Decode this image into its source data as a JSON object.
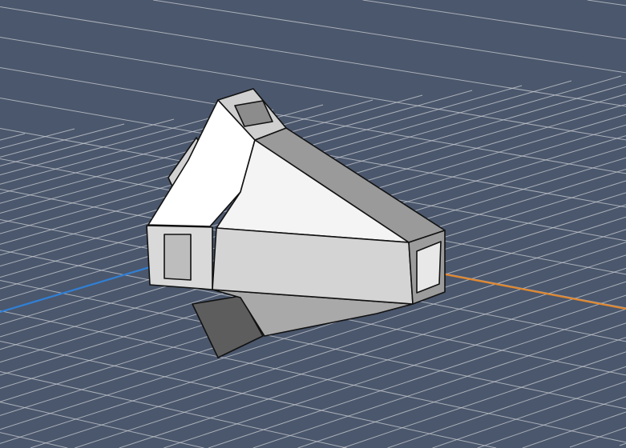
{
  "viewport": {
    "background_color": "#4b576c",
    "grid_color": "#c9cdd3",
    "x_axis_color": "#e0872e",
    "y_axis_color": "#2f7fd6",
    "model_face_light": "#ffffff",
    "model_face_mid": "#d6d6d6",
    "model_face_dark": "#8a8a8a"
  }
}
